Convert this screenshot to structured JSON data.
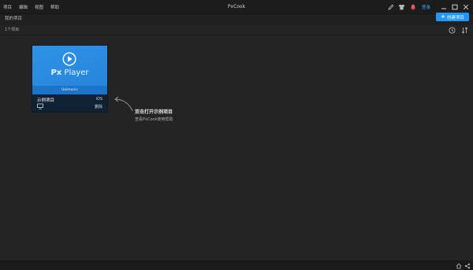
{
  "window": {
    "title": "PxCook",
    "login_label": "登录",
    "menu": [
      "项目",
      "编辑",
      "视图",
      "帮助"
    ]
  },
  "header": {
    "section_label": "我的项目",
    "create_button_label": "创建项目"
  },
  "toolbar": {
    "project_count": "1个项目"
  },
  "project_card": {
    "thumbnail_brand_prefix": "Px",
    "thumbnail_brand_name": "Player",
    "thumbnail_caption": "Ueimonic",
    "name": "示例项目",
    "platform": "iOS",
    "delete_label": "删除"
  },
  "hint": {
    "title": "双击打开示例项目",
    "subtitle": "查看PxCook使用帮助"
  },
  "colors": {
    "accent": "#2196f3",
    "background": "#242424",
    "card_footer": "#0f2133"
  }
}
